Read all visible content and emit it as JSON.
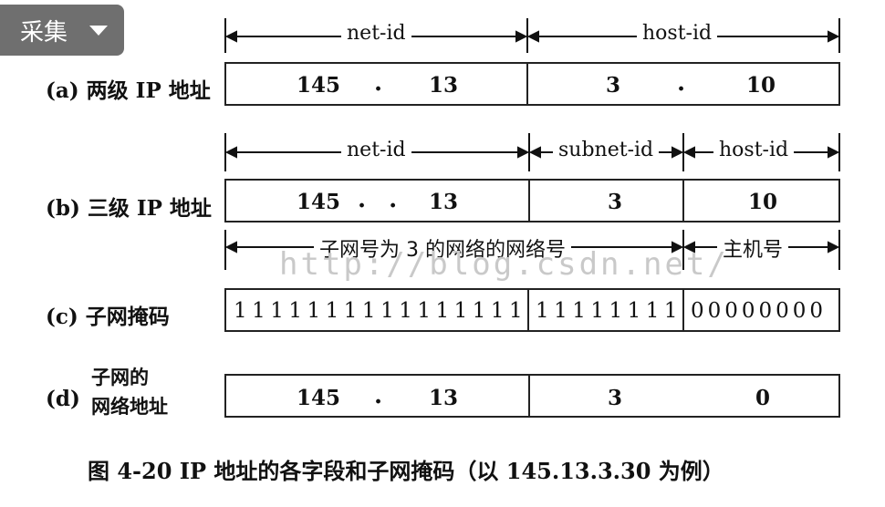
{
  "toolbar": {
    "collect_label": "采集"
  },
  "rows": {
    "a": {
      "label": "(a) 两级 IP 地址",
      "headers": [
        "net-id",
        "host-id"
      ],
      "values": [
        "145",
        ".",
        "13",
        "3",
        ".",
        "10"
      ]
    },
    "b": {
      "label": "(b) 三级 IP 地址",
      "headers": [
        "net-id",
        "subnet-id",
        "host-id"
      ],
      "values": [
        "145",
        ". .",
        "13",
        "3",
        "10"
      ],
      "subheaders": [
        "子网号为 3 的网络的网络号",
        "主机号"
      ]
    },
    "c": {
      "label": "(c) 子网掩码",
      "bits": [
        "1111111111111111",
        "11111111",
        "00000000"
      ]
    },
    "d": {
      "label_line1": "子网的",
      "label_line2": "网络地址",
      "label_prefix": "(d)",
      "values": [
        "145",
        ".",
        "13",
        "3",
        "0"
      ]
    }
  },
  "watermark": "http://blog.csdn.net/",
  "caption": "图 4-20   IP 地址的各字段和子网掩码（以 145.13.3.30 为例）"
}
